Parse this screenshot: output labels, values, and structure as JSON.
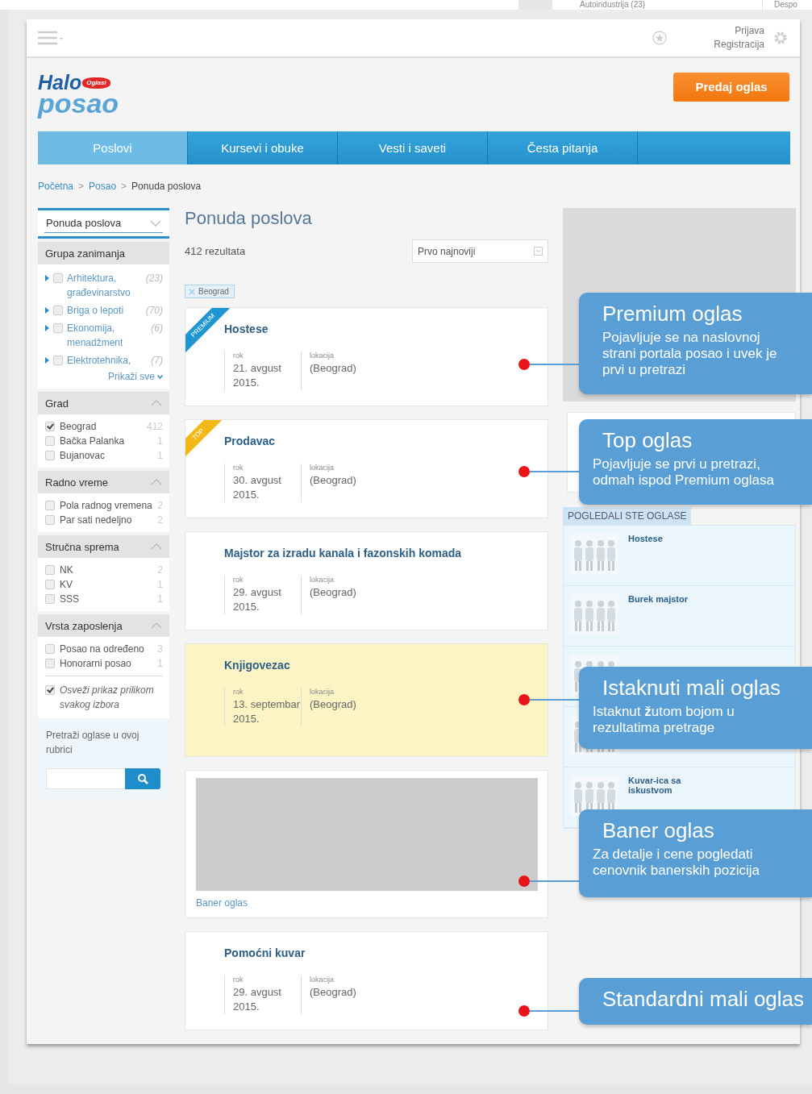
{
  "behind_page": {
    "column_1": "Autoindustrija (23)",
    "column_2": "Despo"
  },
  "top_bar": {
    "links": [
      "Prijava",
      "Registracija"
    ]
  },
  "logo": {
    "line_1": "Halo",
    "badge": "Oglasi",
    "line_2": "posao"
  },
  "submit_button": "Predaj oglas",
  "nav_tabs": [
    {
      "label": "Poslovi",
      "selected": true
    },
    {
      "label": "Kursevi i obuke",
      "selected": false
    },
    {
      "label": "Vesti i saveti",
      "selected": false
    },
    {
      "label": "Česta pitanja",
      "selected": false
    }
  ],
  "breadcrumb": {
    "separator": ">",
    "items": [
      "Početna",
      "Posao",
      "Ponuda poslova"
    ]
  },
  "sidebar": {
    "dropdown": "Ponuda poslova",
    "sections": [
      {
        "title": "Grupa zanimanja",
        "kind": "tree",
        "items": [
          {
            "label": "Arhitektura, građevinarstvo",
            "count": "(23)",
            "checked": false
          },
          {
            "label": "Briga o lepoti",
            "count": "(70)",
            "checked": false
          },
          {
            "label": "Ekonomija, menadžment",
            "count": "(6)",
            "checked": false
          },
          {
            "label": "Elektrotehnika,",
            "count": "(7)",
            "checked": false
          }
        ],
        "show_all": "Prikaži sve"
      },
      {
        "title": "Grad",
        "kind": "checklist",
        "expanded": true,
        "items": [
          {
            "label": "Beograd",
            "count": "412",
            "checked": true
          },
          {
            "label": "Bačka Palanka",
            "count": "1",
            "checked": false
          },
          {
            "label": "Bujanovac",
            "count": "1",
            "checked": false
          }
        ]
      },
      {
        "title": "Radno vreme",
        "kind": "checklist",
        "expanded": true,
        "items": [
          {
            "label": "Pola radnog vremena",
            "count": "2",
            "checked": false
          },
          {
            "label": "Par sati nedeljno",
            "count": "2",
            "checked": false
          }
        ]
      },
      {
        "title": "Stručna sprema",
        "kind": "checklist",
        "expanded": true,
        "items": [
          {
            "label": "NK",
            "count": "2",
            "checked": false
          },
          {
            "label": "KV",
            "count": "1",
            "checked": false
          },
          {
            "label": "SSS",
            "count": "1",
            "checked": false
          }
        ]
      },
      {
        "title": "Vrsta zaposlenja",
        "kind": "checklist",
        "expanded": true,
        "items": [
          {
            "label": "Posao na određeno",
            "count": "3",
            "checked": false
          },
          {
            "label": "Honorarni posao",
            "count": "1",
            "checked": false
          }
        ]
      }
    ],
    "refresh_option": {
      "label": "Osveži prikaz prilikom svakog izbora",
      "checked": true
    },
    "search": {
      "label": "Pretraži oglase u ovoj rubrici"
    }
  },
  "results": {
    "title": "Ponuda poslova",
    "count": "412 rezultata",
    "sort": "Prvo najnoviji",
    "filters": [
      "Beograd"
    ],
    "ads": [
      {
        "kind": "premium",
        "badge": "PREMIUM",
        "title": "Hostese",
        "deadline_label": "rok",
        "deadline": "21. avgust 2015.",
        "location_label": "lokacija",
        "location": "(Beograd)"
      },
      {
        "kind": "top",
        "badge": "TOP",
        "title": "Prodavac",
        "deadline_label": "rok",
        "deadline": "30. avgust 2015.",
        "location_label": "lokacija",
        "location": "(Beograd)"
      },
      {
        "kind": "standard",
        "title": "Majstor za izradu kanala i fazonskih komada",
        "deadline_label": "rok",
        "deadline": "29. avgust 2015.",
        "location_label": "lokacija",
        "location": "(Beograd)"
      },
      {
        "kind": "highlighted",
        "title": "Knjigovezac",
        "deadline_label": "rok",
        "deadline": "13. septembar 2015.",
        "location_label": "lokacija",
        "location": "(Beograd)"
      },
      {
        "kind": "banner",
        "caption": "Baner oglas"
      },
      {
        "kind": "standard",
        "title": "Pomoćni kuvar",
        "deadline_label": "rok",
        "deadline": "29. avgust 2015.",
        "location_label": "lokacija",
        "location": "(Beograd)"
      }
    ]
  },
  "viewed_ads": {
    "title": "POGLEDALI STE OGLASE",
    "items": [
      {
        "thumbnail": {
          "kind": "picture"
        },
        "title": "Hostese"
      },
      {
        "thumbnail": {
          "kind": "picture"
        },
        "title": "Burek majstor"
      },
      {
        "thumbnail": {
          "kind": "picture"
        }
      },
      {
        "thumbnail": {
          "kind": "picture"
        }
      },
      {
        "thumbnail": {
          "kind": "picture"
        },
        "title": "Kuvar-ica sa iskustvom"
      }
    ]
  },
  "callouts": [
    {
      "title": "Premium oglas",
      "text": "Pojavljuje se na naslovnoj strani portala posao i uvek je prvi u pretrazi"
    },
    {
      "title": "Top oglas",
      "text": "Pojavljuje se prvi u pretrazi, odmah ispod Premium oglasa"
    },
    {
      "title": "Istaknuti mali oglas",
      "text": "Istaknut **ž**utom bojom u rezultatima pretrage"
    },
    {
      "title": "Baner oglas",
      "text": "Za detalje i cene pogledati cenovnik banerskih pozicija"
    },
    {
      "title": "Standardni mali oglas"
    }
  ]
}
